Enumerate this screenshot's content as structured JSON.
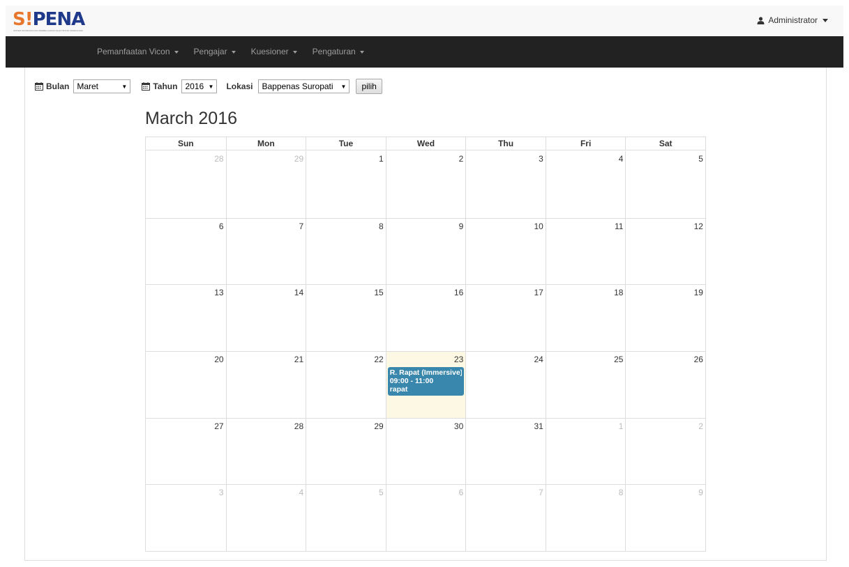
{
  "header": {
    "logo": {
      "s": "S",
      "i": "!",
      "pena": "PENA",
      "tagline": "SISTEM INFORMASI DAN PEMBELAJARAN ELEKTRONIK PERENCANA"
    },
    "user_label": "Administrator"
  },
  "nav": {
    "items": [
      {
        "label": "Pemanfaatan Vicon"
      },
      {
        "label": "Pengajar"
      },
      {
        "label": "Kuesioner"
      },
      {
        "label": "Pengaturan"
      }
    ]
  },
  "filters": {
    "bulan_label": "Bulan",
    "bulan_value": "Maret",
    "tahun_label": "Tahun",
    "tahun_value": "2016",
    "lokasi_label": "Lokasi",
    "lokasi_value": "Bappenas Suropati",
    "submit_label": "pilih"
  },
  "calendar": {
    "title": "March 2016",
    "weekdays": [
      "Sun",
      "Mon",
      "Tue",
      "Wed",
      "Thu",
      "Fri",
      "Sat"
    ],
    "weeks": [
      [
        {
          "n": "28",
          "o": true
        },
        {
          "n": "29",
          "o": true
        },
        {
          "n": "1"
        },
        {
          "n": "2"
        },
        {
          "n": "3"
        },
        {
          "n": "4"
        },
        {
          "n": "5"
        }
      ],
      [
        {
          "n": "6"
        },
        {
          "n": "7"
        },
        {
          "n": "8"
        },
        {
          "n": "9"
        },
        {
          "n": "10"
        },
        {
          "n": "11"
        },
        {
          "n": "12"
        }
      ],
      [
        {
          "n": "13"
        },
        {
          "n": "14"
        },
        {
          "n": "15"
        },
        {
          "n": "16"
        },
        {
          "n": "17"
        },
        {
          "n": "18"
        },
        {
          "n": "19"
        }
      ],
      [
        {
          "n": "20"
        },
        {
          "n": "21"
        },
        {
          "n": "22"
        },
        {
          "n": "23",
          "today": true,
          "event": {
            "title": "R. Rapat (Immersive)",
            "time": "09:00 - 11:00",
            "desc": "rapat"
          }
        },
        {
          "n": "24"
        },
        {
          "n": "25"
        },
        {
          "n": "26"
        }
      ],
      [
        {
          "n": "27"
        },
        {
          "n": "28"
        },
        {
          "n": "29"
        },
        {
          "n": "30"
        },
        {
          "n": "31"
        },
        {
          "n": "1",
          "o": true
        },
        {
          "n": "2",
          "o": true
        }
      ],
      [
        {
          "n": "3",
          "o": true
        },
        {
          "n": "4",
          "o": true
        },
        {
          "n": "5",
          "o": true
        },
        {
          "n": "6",
          "o": true
        },
        {
          "n": "7",
          "o": true
        },
        {
          "n": "8",
          "o": true
        },
        {
          "n": "9",
          "o": true
        }
      ]
    ]
  },
  "colors": {
    "event": "#3a87ad",
    "today": "#fcf8e3",
    "navbar": "#222222",
    "logo_orange": "#e8772e",
    "logo_blue": "#1f3a8a"
  }
}
